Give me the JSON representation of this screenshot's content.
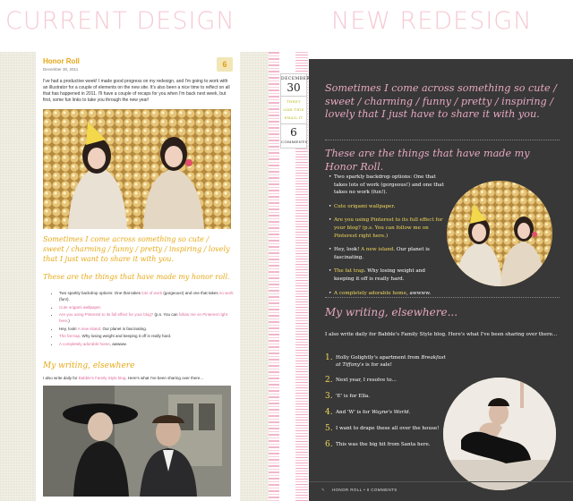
{
  "headers": {
    "left": "CURRENT DESIGN",
    "right": "NEW REDESIGN"
  },
  "colors": {
    "header_pink": "#f6c9d4",
    "current_accent": "#e6a917",
    "link_pink": "#e06a9a",
    "dark_panel": "#383838",
    "redesign_pink": "#e8a9c2",
    "highlight_yellow": "#f2d95b"
  },
  "current": {
    "title": "Honor Roll",
    "date": "December 30, 2011",
    "comment_count": "6",
    "intro": "I've had a productive week! I made good progress on my redesign, and I'm going to work with an illustrator for a couple of elements on the new site. It's also been a nice time to reflect on all that has happened in 2011. I'll have a couple of recaps for you when I'm back next week, but first, some fun links to take you through the new year!",
    "script_quote": "Sometimes I come across something so cute / sweet / charming / funny / pretty / inspiring / lovely that I just want to share it with you.",
    "script_honor": "These are the things that have made my honor roll.",
    "list": [
      {
        "a": "Two sparkly backdrop options: One that takes ",
        "b": "lots of work",
        "c": " (gorgeous!) and one that takes ",
        "d": "no work",
        "e": " (fun!)."
      },
      {
        "a": "",
        "b": "Cute origami wallpaper",
        "c": ".",
        "d": "",
        "e": ""
      },
      {
        "a": "",
        "b": "Are you using Pinterest to its full effect for your blog?",
        "c": " (p.s. You can ",
        "d": "follow me on Pinterest right here",
        "e": ".)"
      },
      {
        "a": "Hey, look! ",
        "b": "A new island",
        "c": ". Our planet is fascinating.",
        "d": "",
        "e": ""
      },
      {
        "a": "",
        "b": "The fat trap",
        "c": ". Why losing weight and keeping it off is really hard.",
        "d": "",
        "e": ""
      },
      {
        "a": "",
        "b": "A completely adorable home",
        "c": ", awwww.",
        "d": "",
        "e": ""
      }
    ],
    "writing_title": "My writing, elsewhere",
    "daily_a": "I also write daily for ",
    "daily_link": "Babble's Family Style blog",
    "daily_b": ". Here's what I've been sharing over there..."
  },
  "redesign": {
    "date_month": "DECEMBER",
    "date_day": "30",
    "links": [
      "TWEET",
      "LIKE THIS",
      "EMAIL IT"
    ],
    "comment_num": "6",
    "comment_label": "COMMENTS",
    "quote": "Sometimes I come across something so cute / sweet / charming / funny / pretty / inspiring / lovely that I just have to share it with you.",
    "honor": "These are the things that have made my Honor Roll.",
    "list": [
      {
        "a": "Two sparkly backdrop options: One that takes lots of work (gorgeous!) and one that takes no work (fun!).",
        "b": "",
        "c": ""
      },
      {
        "a": "",
        "b": "Cute origami wallpaper",
        "c": "."
      },
      {
        "a": "",
        "b": "Are you using Pinterest to its full effect for your blog?",
        "c": " (p.s. You can follow me on Pinterest right here.)"
      },
      {
        "a": "Hey, look! ",
        "b": "A new island",
        "c": ". Our planet is fascinating."
      },
      {
        "a": "",
        "b": "The fat trap",
        "c": ". Why losing weight and keeping it off is really hard."
      },
      {
        "a": "",
        "b": "A completely adorable home",
        "c": ", awwww."
      }
    ],
    "writing_title": "My writing, elsewhere...",
    "daily": "I also write daily for Babble's Family Style blog. Here's what I've been sharing over there...",
    "items": [
      {
        "n": "1.",
        "html_a": "Holly Golightly's apartment from ",
        "em": "Breakfast at Tiffany's",
        "html_b": " is for sale!"
      },
      {
        "n": "2.",
        "html_a": "Next year, I resolve to...",
        "em": "",
        "html_b": ""
      },
      {
        "n": "3.",
        "html_a": "'E' is for Ella.",
        "em": "",
        "html_b": ""
      },
      {
        "n": "4.",
        "html_a": "And 'W' is for ",
        "em": "Wayne's World",
        "html_b": "."
      },
      {
        "n": "5.",
        "html_a": "I want to drape these all over the house!",
        "em": "",
        "html_b": ""
      },
      {
        "n": "6.",
        "html_a": "This was the big hit from Santa here.",
        "em": "",
        "html_b": ""
      }
    ],
    "footer_cat": "HONOR ROLL",
    "footer_sep": " • ",
    "footer_comments": "0 COMMENTS"
  }
}
